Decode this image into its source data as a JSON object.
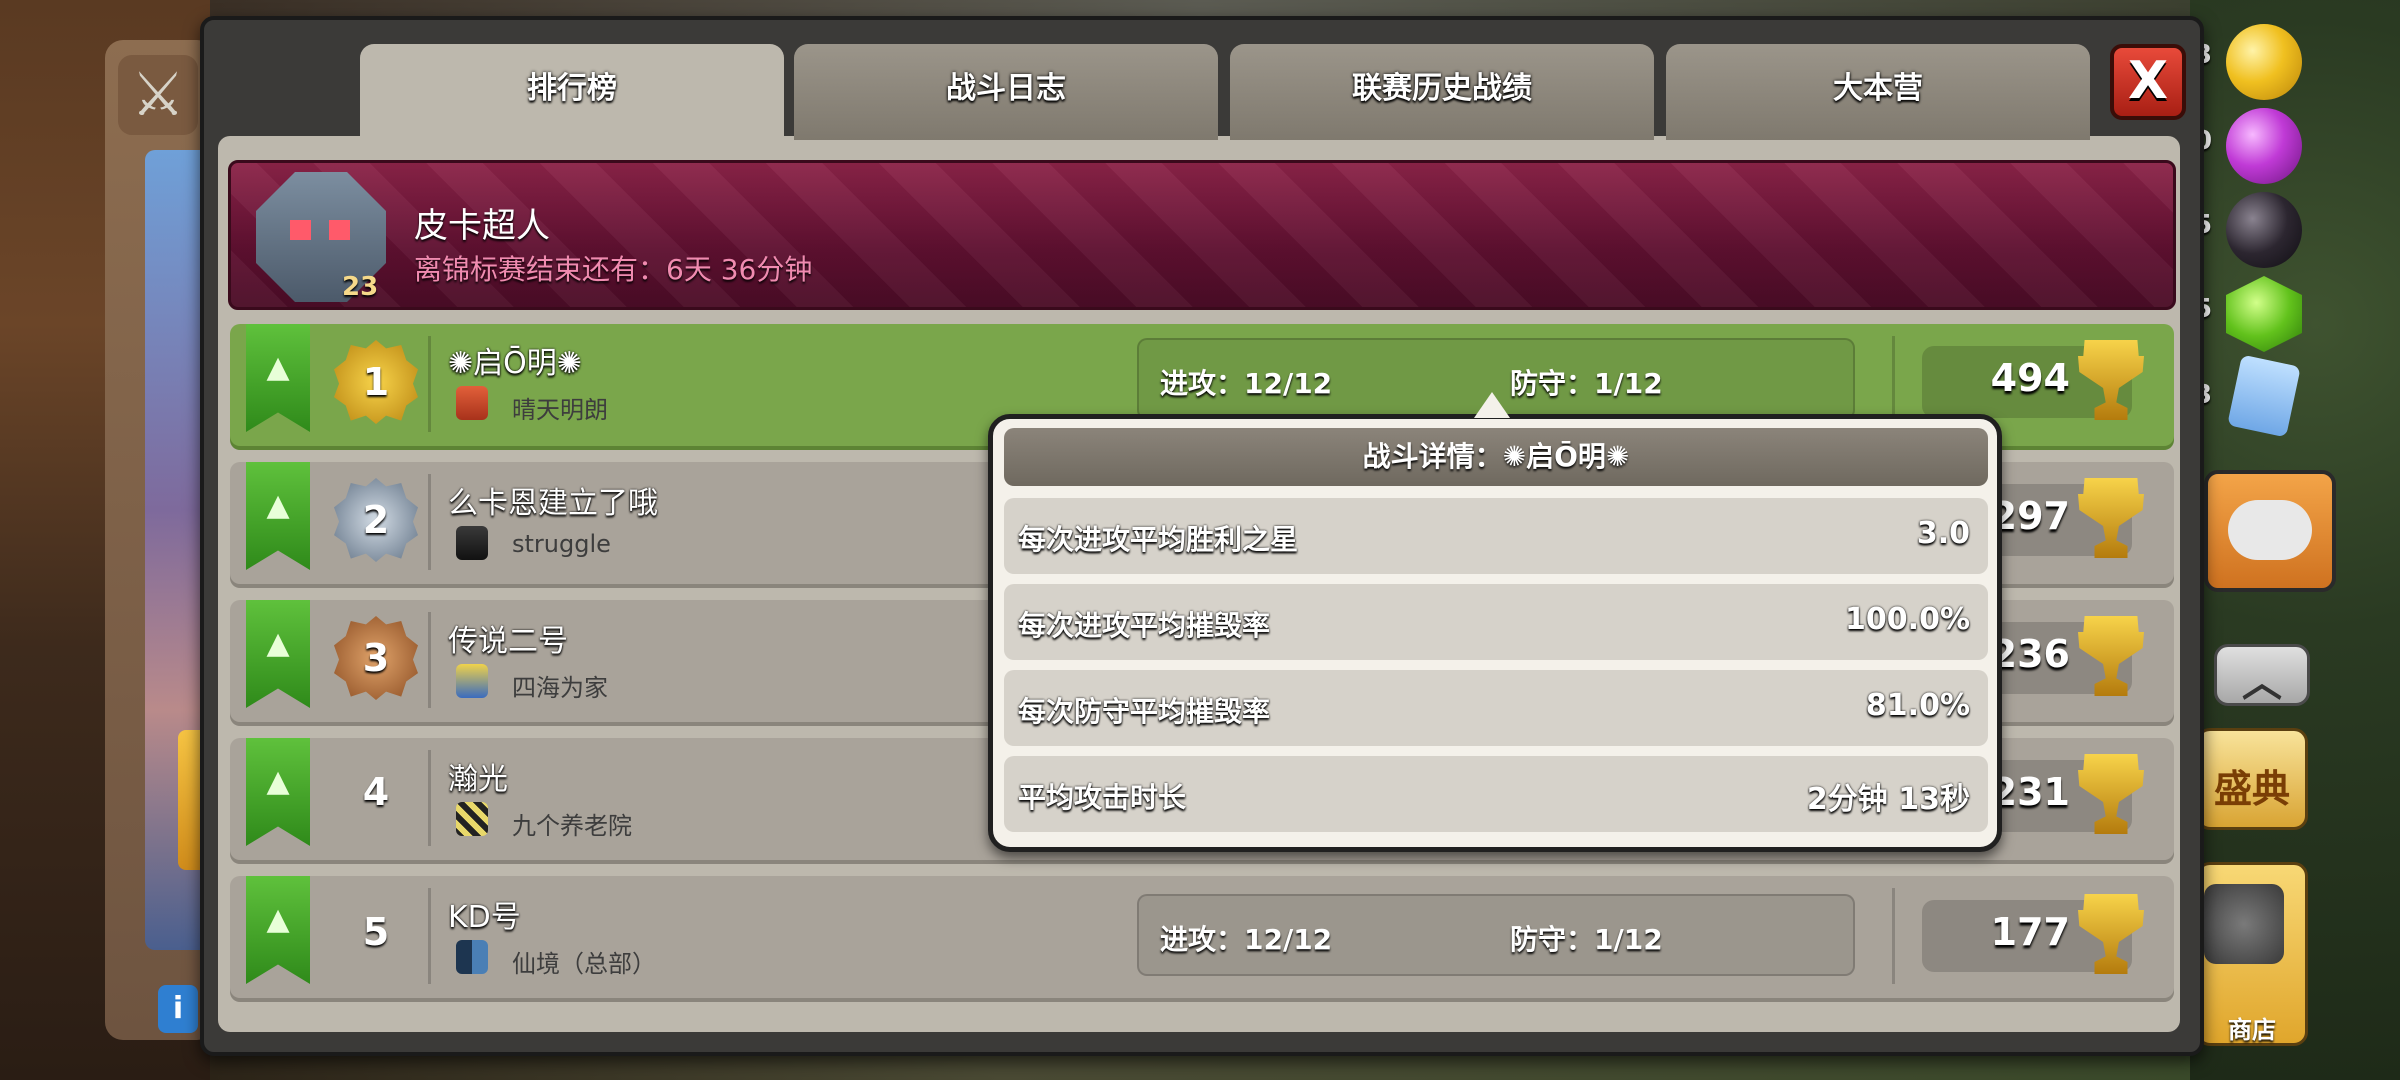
{
  "tabs": [
    {
      "label": "排行榜",
      "active": true
    },
    {
      "label": "战斗日志",
      "active": false
    },
    {
      "label": "联赛历史战绩",
      "active": false
    },
    {
      "label": "大本营",
      "active": false
    }
  ],
  "close_label": "X",
  "banner": {
    "league_level": "23",
    "title": "皮卡超人",
    "subtitle": "离锦标赛结束还有：6天 36分钟"
  },
  "rows": [
    {
      "rank": "1",
      "name": "✺启Ō明✺",
      "clan": "晴天明朗",
      "attack": "进攻：12/12",
      "defense": "防守：1/12",
      "trophies": "494"
    },
    {
      "rank": "2",
      "name": "么卡恩建立了哦",
      "clan": "struggle",
      "trophies": "297"
    },
    {
      "rank": "3",
      "name": "传说二号",
      "clan": "四海为家",
      "trophies": "236"
    },
    {
      "rank": "4",
      "name": "瀚光",
      "clan": "九个养老院",
      "trophies": "231"
    },
    {
      "rank": "5",
      "name": "KD号",
      "clan": "仙境（总部）",
      "attack": "进攻：12/12",
      "defense": "防守：1/12",
      "trophies": "177"
    }
  ],
  "popup": {
    "title": "战斗详情：✺启Ō明✺",
    "stats": [
      {
        "label": "每次进攻平均胜利之星",
        "value": "3.0"
      },
      {
        "label": "每次进攻平均摧毁率",
        "value": "100.0%"
      },
      {
        "label": "每次防守平均摧毁率",
        "value": "81.0%"
      },
      {
        "label": "平均攻击时长",
        "value": "2分钟 13秒"
      }
    ]
  },
  "sidebar": {
    "resource_digits": [
      "3",
      "0",
      "5",
      "5",
      "3"
    ],
    "event_label": "盛典",
    "shop_label": "商店",
    "info_label": "i"
  },
  "colors": {
    "row_highlight": "#7aa64b",
    "row_default": "#a9a39a",
    "banner": "#5e1030",
    "close_button": "#c8291c"
  }
}
